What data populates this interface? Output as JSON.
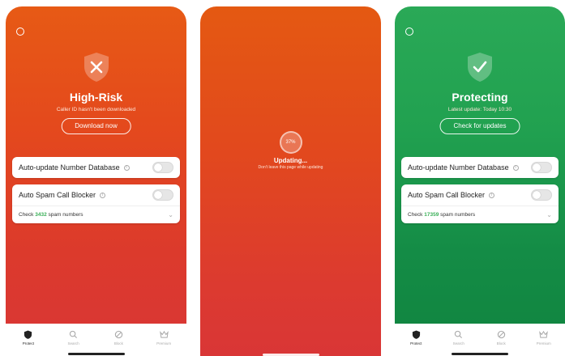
{
  "screens": {
    "high_risk": {
      "status_title": "High-Risk",
      "status_sub": "Caller ID hasn't been downloaded",
      "action_label": "Download now",
      "auto_update_label": "Auto-update Number Database",
      "spam_blocker_label": "Auto Spam Call Blocker",
      "check_prefix": "Check",
      "check_count": "3432",
      "check_suffix": "spam numbers",
      "accent": "#e75a15"
    },
    "updating": {
      "progress_text": "37%",
      "progress_value": 37,
      "title": "Updating...",
      "sub": "Don't leave this page while updating"
    },
    "protecting": {
      "status_title": "Protecting",
      "status_sub": "Latest update: Today 10:30",
      "action_label": "Check for updates",
      "auto_update_label": "Auto-update Number Database",
      "spam_blocker_label": "Auto Spam Call Blocker",
      "check_prefix": "Check",
      "check_count": "17359",
      "check_suffix": "spam numbers",
      "accent": "#2aa957"
    }
  },
  "tabs": [
    {
      "label": "Protect",
      "icon": "shield-icon"
    },
    {
      "label": "Search",
      "icon": "search-icon"
    },
    {
      "label": "Block",
      "icon": "block-icon"
    },
    {
      "label": "Premium",
      "icon": "crown-icon"
    }
  ],
  "colors": {
    "danger": "#e4491d",
    "safe": "#21a150",
    "count_green": "#3bb058"
  }
}
